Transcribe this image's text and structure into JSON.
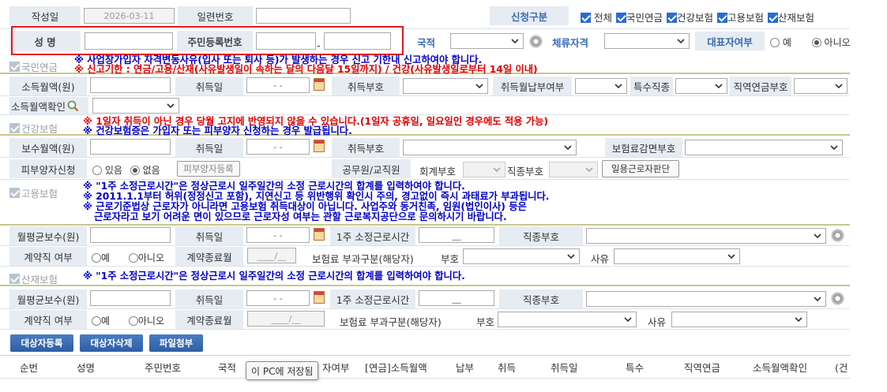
{
  "top": {
    "written_date_label": "작성일",
    "written_date_value": "2026-03-11",
    "serial_no_label": "일련번호",
    "apply_type_label": "신청구분",
    "apply_options": [
      "전체",
      "국민연금",
      "건강보험",
      "고용보험",
      "산재보험"
    ],
    "name_label": "성 명",
    "rrn_label": "주민등록번호",
    "rrn_sep": "-",
    "nationality_label": "국적",
    "residence_label": "체류자격",
    "representative_label": "대표자여부",
    "representative_yes": "예",
    "representative_no": "아니오"
  },
  "pension": {
    "title": "국민연금",
    "note1": "※ 사업장가입자 자격변동사유(입사 또는 퇴사 등)가 발생하는 경우 신고 기한내 신고하여야 합니다.",
    "note2": "※ 신고기한 : 연금/고용/산재(사유발생일이 속하는 달의 다음달 15일까지) / 건강(사유발생일로부터 14일 이내)",
    "income_label": "소득월액(원)",
    "acq_date_label": "취득일",
    "date_placeholder": "- -",
    "acq_code_label": "취득부호",
    "acq_pay_label": "취득월납부여부",
    "special_job_label": "특수직종",
    "job_pension_label": "직역연금부호",
    "income_confirm_label": "소득월액확인"
  },
  "health": {
    "title": "건강보험",
    "note1": "※ 1일자 취득이 아닌 경우 당월 고지에 반영되지 않을 수 있습니다.(1일자 공휴일, 일요일인 경우에도 적용 가능)",
    "note2": "※ 건강보험증은 가입자 또는 피부양자 신청하는 경우 발급됩니다.",
    "pay_label": "보수월액(원)",
    "acq_date_label": "취득일",
    "acq_code_label": "취득부호",
    "reduction_label": "보험료감면부호",
    "dependent_label": "피부양자신청",
    "dep_yes": "있음",
    "dep_no": "없음",
    "dep_button": "피부양자등록",
    "civil_label": "공무원/교직원",
    "account_label": "회계부호",
    "jobcode_label": "직종부호",
    "daily_button": "일용근로자판단"
  },
  "employment": {
    "title": "고용보험",
    "note1": "※ \"1주 소정근로시간\"은 정상근로시 일주일간의  소정 근로시간의 합계를 입력하여야 합니다.",
    "note2": "※ 2011.1.1부터 허위(정정신고 포함), 지연신고 등 위반행위 확인시 주의, 경고없이 즉시 과태료가 부과됩니다.",
    "note3": "※ 근로기준법상 근로자가 아니라면 고용보험 취득대상이 아닙니다. 사업주와 동거친족, 임원(법인이사) 등은",
    "note4": "근로자라고 보기 어려운 면이 있으므로 근로자성 여부는 관할 근로복지공단으로 문의하시기 바랍니다.",
    "avg_pay_label": "월평균보수(원)",
    "acq_date_label": "취득일",
    "weekly_hours_label": "1주 소정근로시간",
    "hours_placeholder": "__",
    "jobcode_label": "직종부호",
    "contract_label": "계약직 여부",
    "yes": "예",
    "no": "아니오",
    "contract_end_label": "계약종료월",
    "month_placeholder": "____/__",
    "premium_label": "보험료 부과구분(해당자)",
    "code_label": "부호",
    "reason_label": "사유"
  },
  "industrial": {
    "title": "산재보험",
    "note1": "※ \"1주 소정근로시간\"은 정상근로시 일주일간의  소정 근로시간의 합계를 입력하여야 합니다.",
    "avg_pay_label": "월평균보수(원)",
    "acq_date_label": "취득일",
    "weekly_hours_label": "1주 소정근로시간",
    "jobcode_label": "직종부호",
    "contract_label": "계약직 여부",
    "contract_end_label": "계약종료월",
    "premium_label": "보험료 부과구분(해당자)",
    "code_label": "부호",
    "reason_label": "사유"
  },
  "buttons": {
    "register": "대상자등록",
    "delete": "대상자삭제",
    "attach": "파일첨부"
  },
  "table": {
    "headers": [
      "순번",
      "성명",
      "주민번호",
      "국적",
      "자여부",
      "[연금]소득월액",
      "납부",
      "취득",
      "취득일",
      "특수",
      "직역연금",
      "소득월액확인",
      "(건"
    ]
  },
  "tooltip": "이 PC에 저장됨",
  "colors": {
    "label_bg": "#e6ecf2",
    "red_note": "#e00000",
    "blue_note": "#0000c8",
    "highlight_box": "#e8141c",
    "button_blue": "#3a6cb4"
  }
}
